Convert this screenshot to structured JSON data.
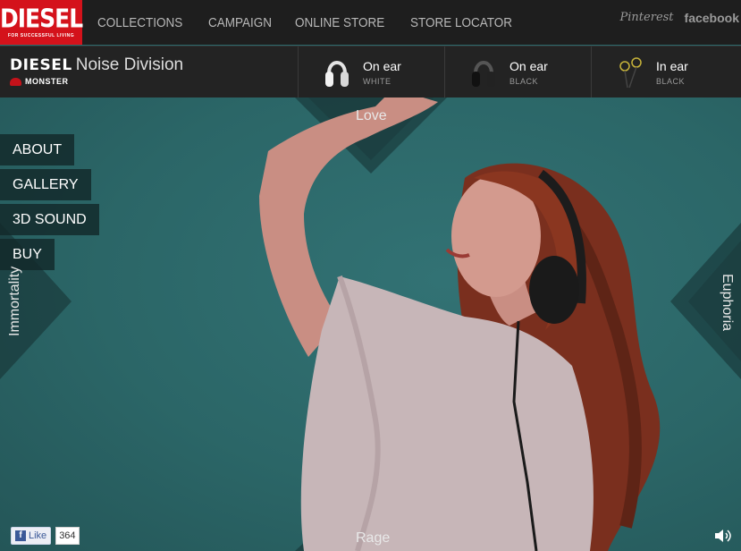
{
  "header": {
    "logo_text": "DIESEL",
    "logo_tagline": "FOR SUCCESSFUL LIVING",
    "nav": [
      "COLLECTIONS",
      "CAMPAIGN",
      "ONLINE STORE",
      "STORE LOCATOR"
    ],
    "social": {
      "pinterest": "Pinterest",
      "facebook": "facebook"
    }
  },
  "product_bar": {
    "brand": "DIESEL",
    "division": "Noise Division",
    "partner": "MONSTER",
    "products": [
      {
        "name": "On ear",
        "color": "WHITE"
      },
      {
        "name": "On ear",
        "color": "BLACK"
      },
      {
        "name": "In ear",
        "color": "BLACK"
      }
    ]
  },
  "side_menu": [
    "ABOUT",
    "GALLERY",
    "3D SOUND",
    "BUY"
  ],
  "directions": {
    "top": "Love",
    "bottom": "Rage",
    "left": "Immortality",
    "right": "Euphoria"
  },
  "like": {
    "label": "Like",
    "count": "364"
  },
  "colors": {
    "brand_red": "#d4121b",
    "hero_teal": "#2d6a6c",
    "bar_dark": "#1e1e1e"
  }
}
